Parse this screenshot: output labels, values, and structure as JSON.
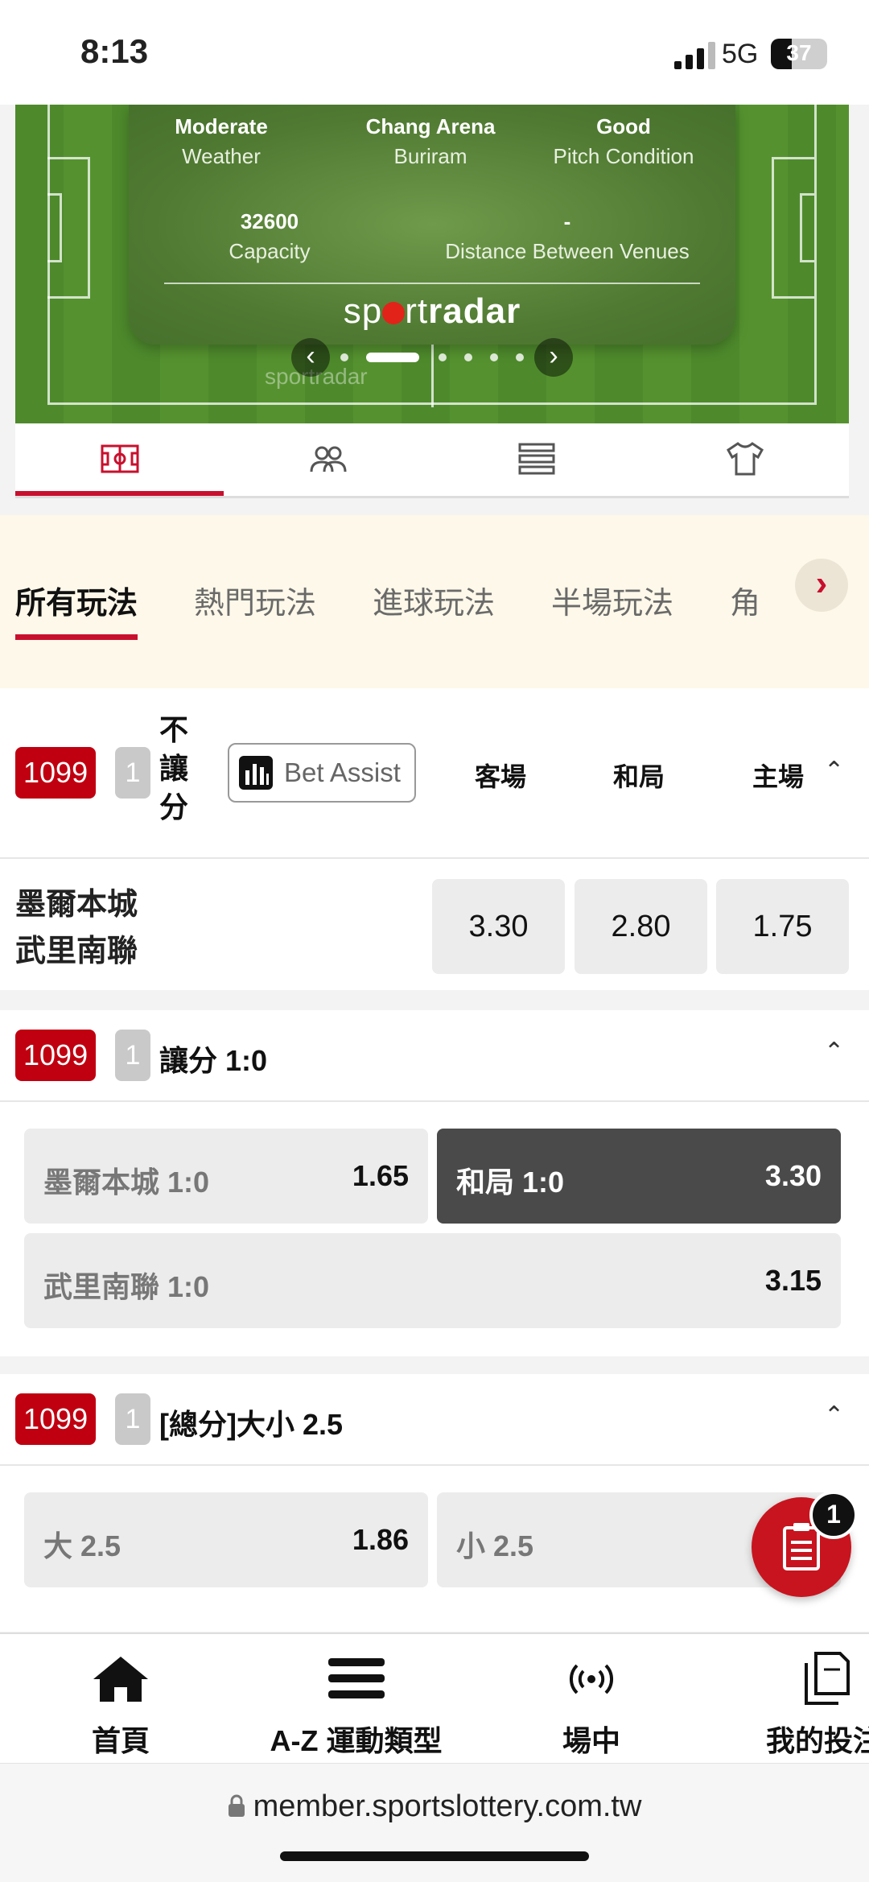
{
  "status": {
    "time": "8:13",
    "network": "5G",
    "battery": "37",
    "battery_fraction": 0.37
  },
  "venue": {
    "weather_value": "Moderate",
    "weather_label": "Weather",
    "stadium_value": "Chang Arena",
    "stadium_label": "Buriram",
    "pitch_value": "Good",
    "pitch_label": "Pitch Condition",
    "capacity_value": "32600",
    "capacity_label": "Capacity",
    "distance_value": "-",
    "distance_label": "Distance Between Venues",
    "brand": {
      "pre": "sp",
      "post": "rt",
      "bold": "radar"
    },
    "watermark": "sportradar",
    "prev_icon": "chevron-left-icon",
    "next_icon": "chevron-right-icon",
    "page_count": 6,
    "active_page": 2
  },
  "icon_tabs": [
    {
      "icon": "pitch-icon",
      "active": true
    },
    {
      "icon": "players-icon",
      "active": false
    },
    {
      "icon": "list-icon",
      "active": false
    },
    {
      "icon": "jersey-icon",
      "active": false
    }
  ],
  "categories": {
    "tabs": [
      "所有玩法",
      "熱門玩法",
      "進球玩法",
      "半場玩法",
      "角"
    ],
    "active": 0,
    "next_icon": "chevron-right-icon"
  },
  "markets": {
    "m1": {
      "code": "1099",
      "num": "1",
      "title": "不讓分",
      "bet_assist": "Bet Assist",
      "columns": [
        "客場",
        "和局",
        "主場"
      ],
      "teams": [
        "墨爾本城",
        "武里南聯"
      ],
      "odds": [
        "3.30",
        "2.80",
        "1.75"
      ]
    },
    "m2": {
      "code": "1099",
      "num": "1",
      "title": "讓分 1:0",
      "selections": [
        {
          "name": "墨爾本城 1:0",
          "price": "1.65",
          "selected": false
        },
        {
          "name": "和局 1:0",
          "price": "3.30",
          "selected": true
        },
        {
          "name": "武里南聯 1:0",
          "price": "3.15",
          "selected": false
        }
      ]
    },
    "m3": {
      "code": "1099",
      "num": "1",
      "title": "[總分]大小 2.5",
      "selections": [
        {
          "name": "大 2.5",
          "price": "1.86"
        },
        {
          "name": "小 2.5",
          "price": ""
        }
      ]
    }
  },
  "betslip": {
    "count": "1",
    "icon": "betslip-icon"
  },
  "bottom_nav": [
    {
      "label": "首頁",
      "icon": "home-icon"
    },
    {
      "label": "A-Z 運動類型",
      "icon": "menu-icon"
    },
    {
      "label": "場中",
      "icon": "live-icon"
    },
    {
      "label": "我的投注",
      "icon": "my-bets-icon"
    }
  ],
  "url": "member.sportslottery.com.tw",
  "colors": {
    "accent": "#c8102e",
    "code_bg": "#c00010",
    "selected_bg": "#4a4a4a"
  }
}
